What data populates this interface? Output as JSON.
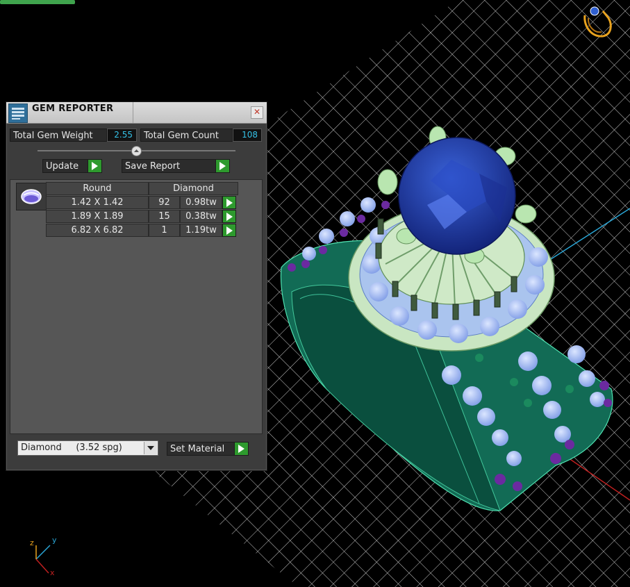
{
  "viewport": {
    "background_color": "#000000",
    "grid_color": "#cfcfcf",
    "axes": {
      "x_label": "x",
      "y_label": "y",
      "z_label": "z"
    }
  },
  "panel": {
    "title": "GEM REPORTER",
    "close_icon": "close-icon",
    "total_gem_weight_label": "Total Gem Weight",
    "total_gem_weight_value": "2.55",
    "total_gem_count_label": "Total Gem Count",
    "total_gem_count_value": "108",
    "update_label": "Update",
    "save_report_label": "Save Report",
    "table": {
      "shape_header": "Round",
      "material_header": "Diamond",
      "rows": [
        {
          "size": "1.42 X 1.42",
          "count": "92",
          "weight": "0.98tw"
        },
        {
          "size": "1.89 X 1.89",
          "count": "15",
          "weight": "0.38tw"
        },
        {
          "size": "6.82 X 6.82",
          "count": "1",
          "weight": "1.19tw"
        }
      ]
    },
    "material_select_value": "Diamond     (3.52 spg)",
    "set_material_label": "Set Material"
  },
  "colors": {
    "accent_green": "#2e9a2e",
    "value_cyan": "#35c2e8",
    "ring_green": "#12705a",
    "gem_blue": "#1f3fae",
    "melee_blue": "#9ab4f2",
    "accent_purple": "#7a1fa0",
    "prong_color": "#b9e6b0"
  }
}
